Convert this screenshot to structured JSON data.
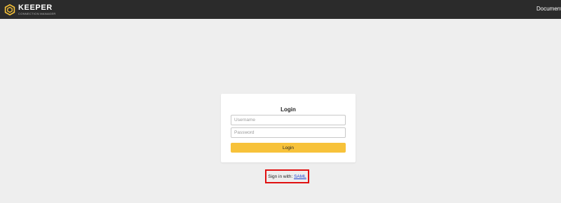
{
  "header": {
    "brand": "KEEPER",
    "brand_sub": "CONNECTION MANAGER",
    "nav_documentation": "Documentation"
  },
  "login": {
    "title": "Login",
    "username_placeholder": "Username",
    "password_placeholder": "Password",
    "button_label": "Login"
  },
  "sso": {
    "prefix": "Sign in with:",
    "link_label": "SAML"
  },
  "colors": {
    "topbar": "#2b2b2b",
    "accent": "#f7c23a",
    "highlight": "#e01010",
    "link": "#1a3fd0"
  },
  "icons": {
    "logo": "keeper-hexagon-logo-icon"
  }
}
